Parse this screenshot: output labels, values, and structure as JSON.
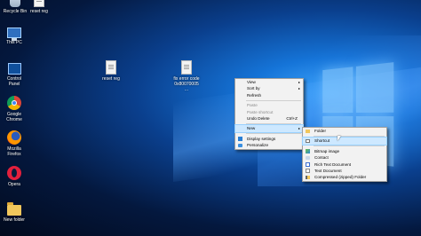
{
  "desktop_icons": [
    {
      "name": "recycle-bin",
      "label": "Recycle Bin",
      "icon": "recycle-bin-icon"
    },
    {
      "name": "reset-reg-top",
      "label": "reset reg",
      "icon": "document-icon"
    },
    {
      "name": "this-pc",
      "label": "This PC",
      "icon": "this-pc-icon"
    },
    {
      "name": "control-panel",
      "label": "Control\nPanel",
      "icon": "control-panel-icon"
    },
    {
      "name": "google-chrome",
      "label": "Google\nChrome",
      "icon": "chrome-icon"
    },
    {
      "name": "mozilla-firefox",
      "label": "Mozilla\nFirefox",
      "icon": "firefox-icon"
    },
    {
      "name": "opera",
      "label": "Opera",
      "icon": "opera-icon"
    },
    {
      "name": "new-folder",
      "label": "New folder",
      "icon": "folder-icon"
    },
    {
      "name": "reset-reg",
      "label": "reset reg",
      "icon": "document-icon"
    },
    {
      "name": "fix-error-code",
      "label": "fix error code\n0x80070005 ...",
      "icon": "document-icon"
    }
  ],
  "context_menu": {
    "items": [
      {
        "label": "View",
        "submenu": true,
        "enabled": true
      },
      {
        "label": "Sort by",
        "submenu": true,
        "enabled": true
      },
      {
        "label": "Refresh",
        "submenu": false,
        "enabled": true
      },
      {
        "label": "Paste",
        "enabled": false
      },
      {
        "label": "Paste shortcut",
        "enabled": false
      },
      {
        "label": "Undo Delete",
        "shortcut": "Ctrl+Z",
        "enabled": true
      },
      {
        "label": "New",
        "submenu": true,
        "enabled": true,
        "highlighted": true
      },
      {
        "label": "Display settings",
        "icon": "display-settings-icon",
        "enabled": true
      },
      {
        "label": "Personalize",
        "icon": "personalize-icon",
        "enabled": true
      }
    ]
  },
  "new_submenu": {
    "items": [
      {
        "label": "Folder",
        "icon": "folder-icon"
      },
      {
        "label": "Shortcut",
        "icon": "shortcut-icon",
        "highlighted": true
      },
      {
        "label": "Bitmap image",
        "icon": "bitmap-image-icon"
      },
      {
        "label": "Contact",
        "icon": "contact-icon"
      },
      {
        "label": "Rich Text Document",
        "icon": "rich-text-icon"
      },
      {
        "label": "Text Document",
        "icon": "text-document-icon"
      },
      {
        "label": "Compressed (zipped) Folder",
        "icon": "zip-folder-icon"
      }
    ]
  },
  "colors": {
    "menu_bg": "#f2f2f2",
    "menu_highlight": "#cde8ff",
    "desktop_blue": "#1574d8"
  }
}
